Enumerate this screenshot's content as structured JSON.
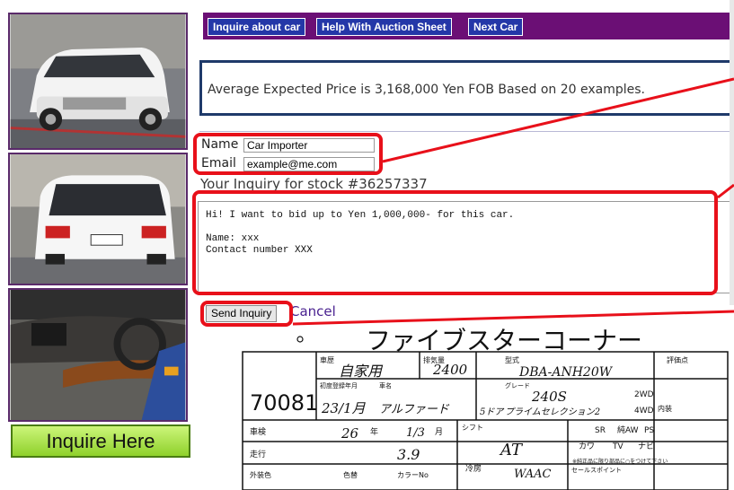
{
  "nav": {
    "inquire": "Inquire about car",
    "help": "Help With Auction Sheet",
    "next": "Next Car"
  },
  "price": {
    "text": "Average Expected Price is 3,168,000 Yen FOB Based on 20 examples."
  },
  "form": {
    "name_label": "Name",
    "name_value": "Car Importer",
    "email_label": "Email",
    "email_value": "example@me.com",
    "stock_line": "Your Inquiry for stock #36257337",
    "message": "Hi! I want to bid up to Yen 1,000,000- for this car.\n\nName: xxx\nContact number XXX",
    "send_label": "Send Inquiry",
    "cancel_label": "Cancel"
  },
  "sidebar": {
    "inquire_here": "Inquire Here"
  },
  "sheet": {
    "title": "ファイブスターコーナー",
    "lot": "70081",
    "small_labels": [
      "車歴",
      "排気量",
      "型式",
      "評価点",
      "初度登録年月",
      "車名",
      "グレード",
      "車検",
      "年",
      "月",
      "シフト",
      "走行",
      "冷房",
      "外装色",
      "色替",
      "カラーNo",
      "セールスポイント",
      "内装"
    ],
    "handwritten": [
      "自家用",
      "2400",
      "DBA-ANH20W",
      "23/1月",
      "アルファード",
      "240S",
      "5ドア",
      "プライムセレクション2",
      "26",
      "1/3",
      "3.9",
      "AT",
      "WAAC"
    ],
    "equipment": [
      "カワ",
      "TV",
      "ナビ",
      "SR",
      "純AW",
      "PS",
      "2WD",
      "4WD"
    ],
    "note": "※純正品に限り部品に○をつけて下さい"
  },
  "colors": {
    "nav_bar": "#6b0f75",
    "nav_button": "#2437a8",
    "price_border": "#1f3a6a",
    "highlight": "#e8101a",
    "inquire_green": "#8fd12b"
  }
}
